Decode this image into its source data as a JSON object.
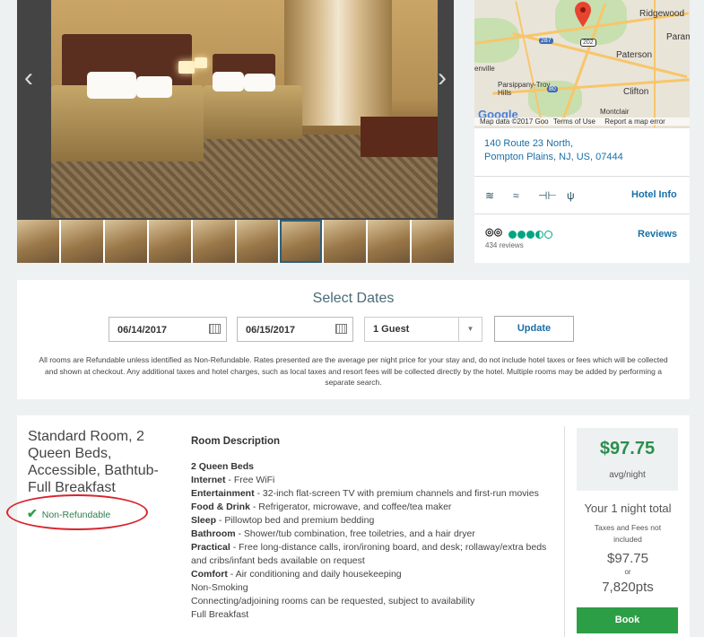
{
  "map": {
    "labels": [
      "Ridgewood",
      "Param",
      "Paterson",
      "Clifton",
      "Montclair",
      "enville",
      "Parsippany-Troy Hills"
    ],
    "shields": [
      "287",
      "202",
      "80"
    ],
    "footer": "Map data ©2017 Goo",
    "terms": "Terms of Use",
    "report": "Report a map error",
    "logo": "Google"
  },
  "hotel": {
    "address_line1": "140 Route 23 North,",
    "address_line2": "Pompton Plains, NJ, US, 07444",
    "amenity_icons": [
      "wifi-icon",
      "pool-icon",
      "fitness-icon",
      "restaurant-icon"
    ],
    "hotel_info_link": "Hotel Info",
    "reviews_link": "Reviews",
    "review_count": "434 reviews",
    "rating": 3.5
  },
  "dates": {
    "title": "Select Dates",
    "checkin": "06/14/2017",
    "checkout": "06/15/2017",
    "guests": "1 Guest",
    "update_label": "Update",
    "disclaimer": "All rooms are Refundable unless identified as Non-Refundable. Rates presented are the average per night price for your stay and, do not include hotel taxes or fees which will be collected and shown at checkout. Any additional taxes and hotel charges, such as local taxes and resort fees will be collected directly by the hotel. Multiple rooms may be added by performing a separate search."
  },
  "room": {
    "title": "Standard Room, 2 Queen Beds, Accessible, Bathtub-Full Breakfast",
    "refund_label": "Non-Refundable",
    "description_heading": "Room Description",
    "beds": "2 Queen Beds",
    "features": [
      {
        "label": "Internet",
        "text": " - Free WiFi"
      },
      {
        "label": "Entertainment",
        "text": " - 32-inch flat-screen TV with premium channels and first-run movies"
      },
      {
        "label": "Food & Drink",
        "text": " - Refrigerator, microwave, and coffee/tea maker"
      },
      {
        "label": "Sleep",
        "text": " - Pillowtop bed and premium bedding"
      },
      {
        "label": "Bathroom",
        "text": " - Shower/tub combination, free toiletries, and a hair dryer"
      },
      {
        "label": "Practical",
        "text": " - Free long-distance calls, iron/ironing board, and desk; rollaway/extra beds and cribs/infant beds available on request"
      },
      {
        "label": "Comfort",
        "text": " - Air conditioning and daily housekeeping"
      }
    ],
    "extra_lines": [
      "Non-Smoking",
      "Connecting/adjoining rooms can be requested, subject to availability",
      "Full Breakfast"
    ],
    "price": "$97.75",
    "price_unit": "avg/night",
    "total_label": "Your 1 night total",
    "taxes_note": "Taxes and Fees not included",
    "total_price": "$97.75",
    "or": "or",
    "points": "7,820pts",
    "book_label": "Book"
  },
  "gallery": {
    "thumbnail_count": 10,
    "selected_index": 6
  }
}
